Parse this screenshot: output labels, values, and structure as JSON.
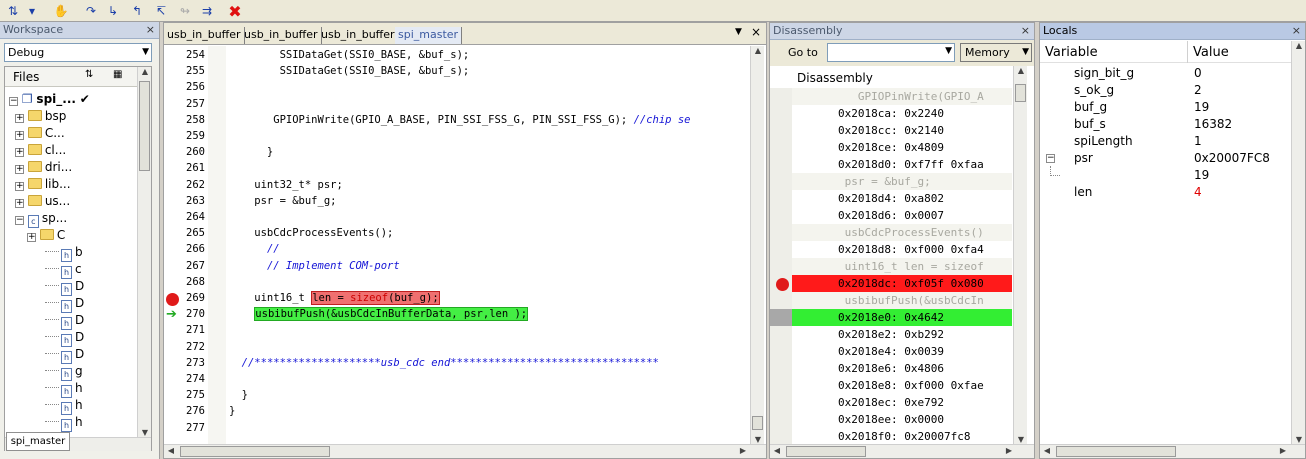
{
  "workspace": {
    "title": "Workspace",
    "config": "Debug",
    "files_label": "Files",
    "project": "spi_...",
    "bottom_tab": "spi_master",
    "tree": [
      "bsp",
      "C...",
      "cl...",
      "dri...",
      "lib...",
      "us...",
      "sp...",
      "C",
      "b",
      "c",
      "D",
      "D",
      "D",
      "D",
      "D",
      "g",
      "h",
      "h",
      "h"
    ]
  },
  "editor": {
    "tabs": [
      "usb_in_buffer",
      "usb_in_buffer",
      "usb_in_buffer",
      "spi_master"
    ],
    "close": "×",
    "lines": [
      {
        "n": "254",
        "code": "        SSIDataGet(SSI0_BASE, &buf_s);"
      },
      {
        "n": "255",
        "code": "        SSIDataGet(SSI0_BASE, &buf_s);"
      },
      {
        "n": "256",
        "code": ""
      },
      {
        "n": "257",
        "code": ""
      },
      {
        "n": "258",
        "code": "       GPIOPinWrite(GPIO_A_BASE, PIN_SSI_FSS_G, PIN_SSI_FSS_G); ",
        "comment": "//chip se"
      },
      {
        "n": "259",
        "code": ""
      },
      {
        "n": "260",
        "code": "      }"
      },
      {
        "n": "261",
        "code": ""
      },
      {
        "n": "262",
        "code": "    uint32_t* psr;"
      },
      {
        "n": "263",
        "code": "    psr = &buf_g;"
      },
      {
        "n": "264",
        "code": ""
      },
      {
        "n": "265",
        "code": "    usbCdcProcessEvents();"
      },
      {
        "n": "266",
        "code": "      ",
        "comment": "//"
      },
      {
        "n": "267",
        "code": "      ",
        "comment": "// Implement COM-port"
      },
      {
        "n": "268",
        "code": ""
      },
      {
        "n": "269",
        "code": "    uint16_t "
      },
      {
        "n": "270",
        "code": "    "
      },
      {
        "n": "271",
        "code": ""
      },
      {
        "n": "272",
        "code": ""
      },
      {
        "n": "273",
        "code": "  ",
        "comment": "//********************usb_cdc end*********************************"
      },
      {
        "n": "274",
        "code": ""
      },
      {
        "n": "275",
        "code": "  }"
      },
      {
        "n": "276",
        "code": "}"
      },
      {
        "n": "277",
        "code": ""
      }
    ],
    "bp_stmt_a": "len = ",
    "bp_kw": "sizeof",
    "bp_stmt_b": "(buf_g);",
    "cur_stmt": "usbibufPush(&usbCdcInBufferData, psr,len );"
  },
  "disasm": {
    "title": "Disassembly",
    "goto_label": "Go to",
    "memory_btn": "Memory",
    "header": "Disassembly",
    "rows": [
      {
        "t": "src",
        "text": "   GPIOPinWrite(GPIO_A"
      },
      {
        "t": "asm",
        "text": "0x2018ca: 0x2240"
      },
      {
        "t": "asm",
        "text": "0x2018cc: 0x2140"
      },
      {
        "t": "asm",
        "text": "0x2018ce: 0x4809"
      },
      {
        "t": "asm",
        "text": "0x2018d0: 0xf7ff 0xfaa"
      },
      {
        "t": "src",
        "text": " psr = &buf_g;"
      },
      {
        "t": "asm",
        "text": "0x2018d4: 0xa802"
      },
      {
        "t": "asm",
        "text": "0x2018d6: 0x0007"
      },
      {
        "t": "src",
        "text": " usbCdcProcessEvents()"
      },
      {
        "t": "asm",
        "text": "0x2018d8: 0xf000 0xfa4"
      },
      {
        "t": "src",
        "text": " uint16_t len = sizeof"
      },
      {
        "t": "bp",
        "text": "0x2018dc: 0xf05f 0x080"
      },
      {
        "t": "src",
        "text": " usbibufPush(&usbCdcIn"
      },
      {
        "t": "cur",
        "text": "0x2018e0: 0x4642"
      },
      {
        "t": "asm",
        "text": "0x2018e2: 0xb292"
      },
      {
        "t": "asm",
        "text": "0x2018e4: 0x0039"
      },
      {
        "t": "asm",
        "text": "0x2018e6: 0x4806"
      },
      {
        "t": "asm",
        "text": "0x2018e8: 0xf000 0xfae"
      },
      {
        "t": "asm",
        "text": "0x2018ec: 0xe792"
      },
      {
        "t": "asm",
        "text": "0x2018ee: 0x0000"
      },
      {
        "t": "asm",
        "text": "0x2018f0: 0x20007fc8"
      }
    ]
  },
  "locals": {
    "title": "Locals",
    "col_var": "Variable",
    "col_val": "Value",
    "rows": [
      {
        "name": "sign_bit_g",
        "value": "0"
      },
      {
        "name": "s_ok_g",
        "value": "2"
      },
      {
        "name": "buf_g",
        "value": "19"
      },
      {
        "name": "buf_s",
        "value": "16382"
      },
      {
        "name": "spiLength",
        "value": "1"
      },
      {
        "name": "psr",
        "value": "0x20007FC8"
      },
      {
        "name": "",
        "value": "19"
      },
      {
        "name": "len",
        "value": "4"
      }
    ]
  },
  "colors": {
    "breakpoint": "#f07070",
    "current": "#44ee44",
    "len_value": "#e00000"
  }
}
